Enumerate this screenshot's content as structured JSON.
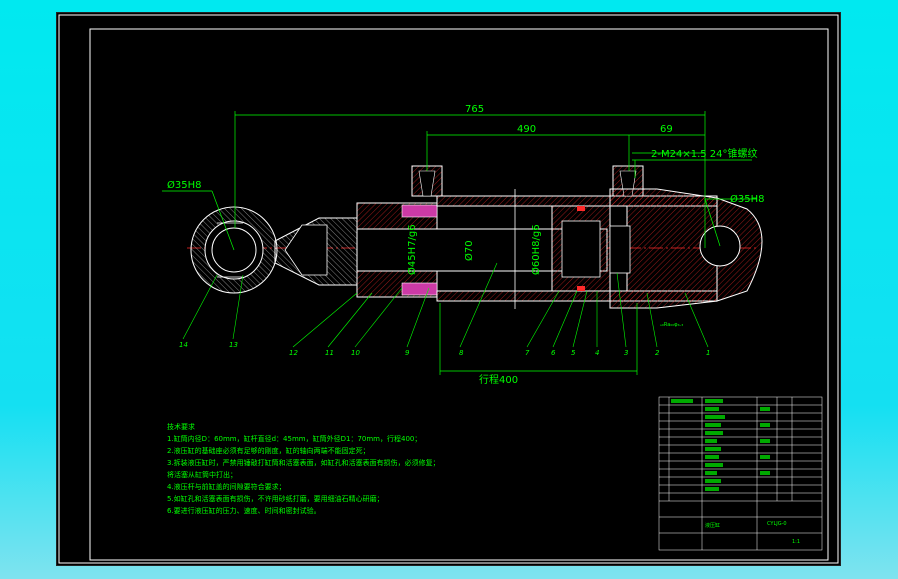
{
  "dimensions": {
    "overall": "765",
    "body": "490",
    "end": "69",
    "thread": "2-M24×1.5 24°锥螺纹",
    "left_eye": "Ø35H8",
    "right_eye": "Ø35H8",
    "fit1": "Ø45H7/g6",
    "rod": "Ø70",
    "fit2": "Ø60H8/g6",
    "stroke": "行程400",
    "side_note": "ₛ₀Ra₀₀φ₆.₃"
  },
  "balloons": [
    "14",
    "13",
    "12",
    "11",
    "10",
    "9",
    "8",
    "7",
    "6",
    "5",
    "4",
    "3",
    "2",
    "1"
  ],
  "tech_req": {
    "title": "技术要求",
    "lines": [
      "1.缸筒内径D：60mm，缸杆直径d：45mm，缸筒外径D1：70mm，行程400；",
      "2.液压缸的基础座必须有足够的刚度，缸的轴向两端不能固定死；",
      "3.拆装液压缸时，严禁用锤敲打缸筒和活塞表面，如缸孔和活塞表面有损伤，必须修复；",
      "  将活塞从缸筒中打出；",
      "4.液压杆与前缸盖的间隙要符合要求；",
      "5.如缸孔和活塞表面有损伤，不许用砂纸打磨，要用细油石精心研磨；",
      "6.要进行液压缸的压力、速度、时间和密封试验。"
    ]
  },
  "title_block": {
    "drawing_no": "CYLJG-0",
    "name": "液压缸",
    "scale": "1:1"
  }
}
